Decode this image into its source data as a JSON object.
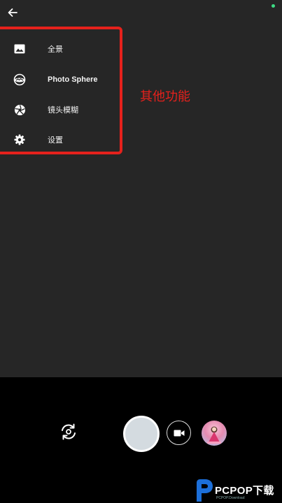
{
  "header": {
    "back_icon": "arrow-left-icon",
    "status_dot_color": "#3ddc84"
  },
  "menu": {
    "items": [
      {
        "label": "全景",
        "icon": "image-icon"
      },
      {
        "label": "Photo Sphere",
        "icon": "photo-sphere-icon"
      },
      {
        "label": "镜头模糊",
        "icon": "aperture-icon"
      },
      {
        "label": "设置",
        "icon": "gear-icon"
      }
    ]
  },
  "annotation": {
    "text": "其他功能",
    "color": "#e5211c"
  },
  "controls": {
    "switch_camera_icon": "switch-camera-icon",
    "shutter_icon": "shutter-button",
    "video_icon": "video-camera-icon",
    "thumbnail_icon": "gallery-thumbnail"
  },
  "watermark": {
    "text": "PCPOP下载",
    "subtext": "PCPOP.Download"
  },
  "colors": {
    "viewfinder": "#262626",
    "controls_bar": "#000000",
    "highlight": "#e5211c",
    "shutter_fill": "#d4dbe0"
  }
}
